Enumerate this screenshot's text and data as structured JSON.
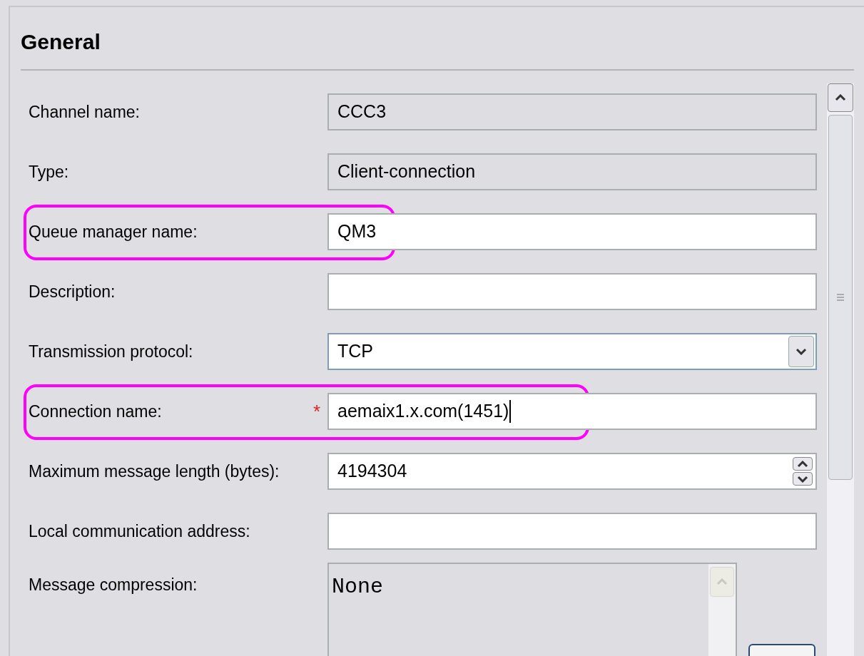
{
  "section": {
    "title": "General"
  },
  "fields": [
    {
      "kind": "readonly",
      "label": "Channel name:",
      "value": "CCC3",
      "highlighted": false
    },
    {
      "kind": "readonly",
      "label": "Type:",
      "value": "Client-connection",
      "highlighted": false
    },
    {
      "kind": "text",
      "label": "Queue manager name:",
      "value": "QM3",
      "highlighted": true
    },
    {
      "kind": "text",
      "label": "Description:",
      "highlighted": false
    },
    {
      "kind": "dropdown",
      "label": "Transmission protocol:",
      "value": "TCP",
      "highlighted": false
    },
    {
      "kind": "text",
      "label": "Connection name:",
      "value": "aemaix1.x.com(1451)",
      "required_mark": "*",
      "focused": true,
      "highlighted": true
    },
    {
      "kind": "spinner",
      "label": "Maximum message length (bytes):",
      "value": "4194304",
      "highlighted": false
    },
    {
      "kind": "text",
      "label": "Local communication address:",
      "highlighted": false
    },
    {
      "kind": "list",
      "label": "Message compression:",
      "value": "None",
      "highlighted": false
    }
  ]
}
